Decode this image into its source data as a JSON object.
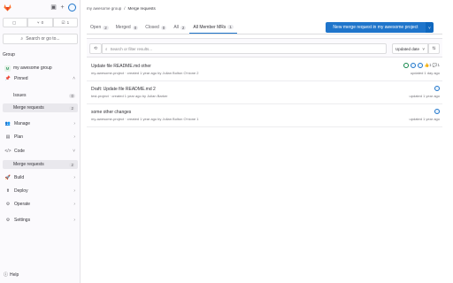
{
  "sidebar": {
    "counts": [
      {
        "icon": "issues-icon",
        "glyph": "▢",
        "value": ""
      },
      {
        "icon": "merge-request-icon",
        "glyph": "⑂",
        "value": "0"
      },
      {
        "icon": "todo-icon",
        "glyph": "☑",
        "value": "1"
      }
    ],
    "search_label": "Search or go to...",
    "context_header": "Group",
    "group_name": "my awesome group",
    "group_initial": "M",
    "pinned_label": "Pinned",
    "pinned_items": [
      {
        "label": "Issues",
        "count": "0"
      },
      {
        "label": "Merge requests",
        "count": "2"
      }
    ],
    "nav_items": [
      {
        "label": "Manage",
        "glyph": "👥"
      },
      {
        "label": "Plan",
        "glyph": "▤"
      },
      {
        "label": "Code",
        "glyph": "</>"
      }
    ],
    "code_sub": {
      "label": "Merge requests",
      "count": "2"
    },
    "nav_items_2": [
      {
        "label": "Build",
        "glyph": "🚀"
      },
      {
        "label": "Deploy",
        "glyph": "⬆"
      },
      {
        "label": "Operate",
        "glyph": "⚙"
      },
      {
        "label": "Settings",
        "glyph": "⚙"
      }
    ],
    "help_label": "Help"
  },
  "breadcrumb": {
    "parent": "my awesome group",
    "sep": "/",
    "current": "Merge requests"
  },
  "tabs": [
    {
      "label": "Open",
      "count": "2"
    },
    {
      "label": "Merged",
      "count": "0"
    },
    {
      "label": "Closed",
      "count": "0"
    },
    {
      "label": "All",
      "count": "2"
    },
    {
      "label": "All Member MRs",
      "count": "1"
    }
  ],
  "new_mr_label": "New merge request in my awesome project",
  "filter": {
    "placeholder": "Search or filter results...",
    "sort_label": "Updated date"
  },
  "merge_requests": [
    {
      "title": "Update file README.md other",
      "meta": "my-awesome-project · created 1 year ago by Julian Bolton O'nione 2",
      "updated": "updated 1 day ago",
      "stats": "👍1  💬1"
    },
    {
      "title": "Draft: Update file README.md 2",
      "meta": "test-project · created 1 year ago by Julian Barker",
      "updated": "updated 1 year ago",
      "stats": ""
    },
    {
      "title": "some other changes",
      "meta": "my-awesome-project · created 1 year ago by Julian Bolton O'nione 1",
      "updated": "updated 1 year ago",
      "stats": ""
    }
  ],
  "colors": {
    "accent": "#1f75cb",
    "brand": "#fc6d26"
  }
}
